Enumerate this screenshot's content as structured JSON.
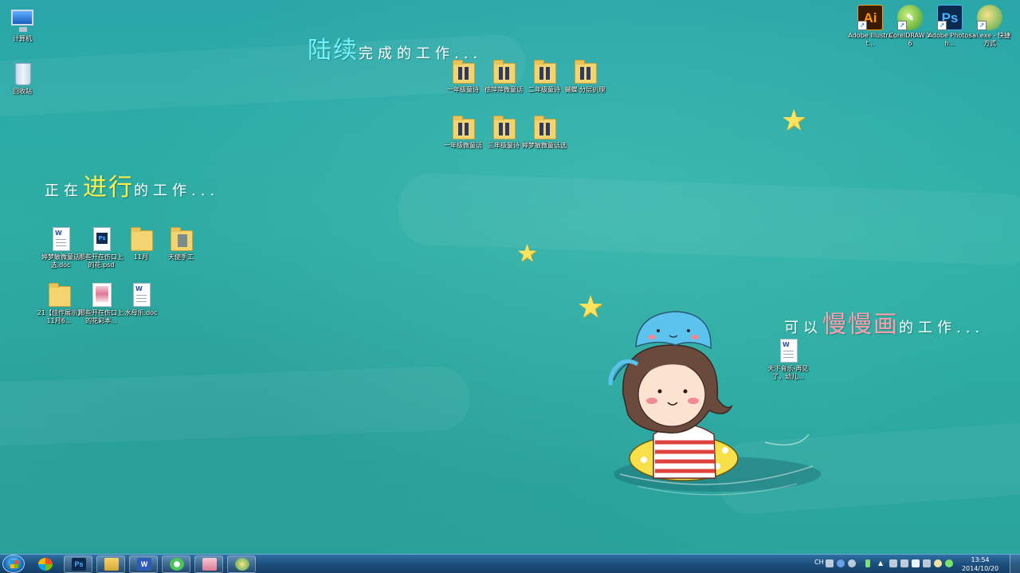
{
  "desktop": {
    "system_icons": [
      {
        "label": "计算机",
        "icon": "computer-icon"
      },
      {
        "label": "回收站",
        "icon": "recycle-bin-icon"
      }
    ],
    "app_shortcuts": [
      {
        "label": "Adobe Illustrat...",
        "glyph": "Ai",
        "icon": "adobe-illustrator-icon"
      },
      {
        "label": "CorelDRAW X6",
        "glyph": "",
        "icon": "coreldraw-icon"
      },
      {
        "label": "Adobe Photosh...",
        "glyph": "Ps",
        "icon": "adobe-photoshop-icon"
      },
      {
        "label": "sai.exe - 快捷方式",
        "glyph": "",
        "icon": "sai-icon"
      }
    ],
    "headings": {
      "continued": {
        "highlight": "陆续",
        "rest": "完成的工作..."
      },
      "in_progress": {
        "prefix": "正在",
        "highlight": "进行",
        "rest": "的工作..."
      },
      "slow": {
        "prefix": "可以",
        "highlight": "慢慢画",
        "rest": "的工作..."
      }
    },
    "continued_items": [
      {
        "label": "一年级童诗",
        "type": "folder"
      },
      {
        "label": "徐萍萍微童话",
        "type": "folder"
      },
      {
        "label": "二年级童诗",
        "type": "folder"
      },
      {
        "label": "蝴蝶 分层扒理",
        "type": "folder"
      },
      {
        "label": "一年级微童话",
        "type": "folder"
      },
      {
        "label": "三年级童诗",
        "type": "folder"
      },
      {
        "label": "婷梦敏微童话选",
        "type": "folder"
      }
    ],
    "in_progress_items": [
      {
        "label": "婷梦敏微童话选.doc",
        "type": "doc"
      },
      {
        "label": "那些开在伤口上的花.psd",
        "type": "psd"
      },
      {
        "label": "11月",
        "type": "folder"
      },
      {
        "label": "天使手工",
        "type": "folder"
      },
      {
        "label": "21【佳作展示】11月6...",
        "type": "folder"
      },
      {
        "label": "那些开在伤口上的花彩本...",
        "type": "image"
      },
      {
        "label": "水母乐.doc",
        "type": "doc"
      }
    ],
    "slow_items": [
      {
        "label": "天下音乐-再见了，幼儿...",
        "type": "doc"
      }
    ],
    "colors": {
      "star": "#ffe35a",
      "continued_highlight": "#6ff3ff",
      "in_progress_highlight": "#fff04a",
      "slow_highlight": "#ff9fae"
    }
  },
  "taskbar": {
    "buttons": [
      {
        "icon": "photoshop-taskbar-icon",
        "glyph": "Ps"
      },
      {
        "icon": "file-explorer-icon",
        "glyph": ""
      },
      {
        "icon": "word-icon",
        "glyph": "W"
      },
      {
        "icon": "refresh-app-icon",
        "glyph": ""
      },
      {
        "icon": "image-viewer-icon",
        "glyph": ""
      },
      {
        "icon": "sai-taskbar-icon",
        "glyph": ""
      }
    ],
    "tray": {
      "language": "CH",
      "time": "13:54",
      "date": "2014/10/20"
    }
  }
}
